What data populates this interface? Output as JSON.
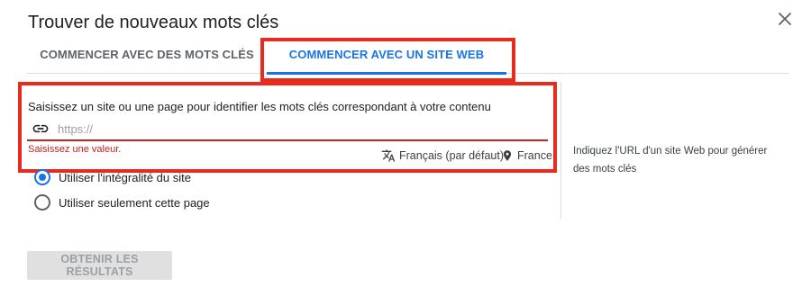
{
  "dialog": {
    "title": "Trouver de nouveaux mots clés",
    "close_icon": "close-icon"
  },
  "tabs": [
    {
      "label": "COMMENCER AVEC DES MOTS CLÉS",
      "active": false
    },
    {
      "label": "COMMENCER AVEC UN SITE WEB",
      "active": true
    }
  ],
  "form": {
    "instruction": "Saisissez un site ou une page pour identifier les mots clés correspondant à votre contenu",
    "url_input": {
      "value": "",
      "placeholder": "https://"
    },
    "link_icon": "link-icon",
    "error": "Saisissez une valeur.",
    "language": {
      "icon": "translate-icon",
      "label": "Français (par défaut)"
    },
    "location": {
      "icon": "location-pin-icon",
      "label": "France"
    },
    "scope_options": [
      {
        "label": "Utiliser l'intégralité du site",
        "selected": true
      },
      {
        "label": "Utiliser seulement cette page",
        "selected": false
      }
    ]
  },
  "help": {
    "text": "Indiquez l'URL d'un site Web pour générer des mots clés"
  },
  "submit": {
    "label": "OBTENIR LES RÉSULTATS",
    "enabled": false
  },
  "colors": {
    "accent": "#1a73e8",
    "error": "#c5221f",
    "annotation_highlight": "#e82a1f"
  }
}
